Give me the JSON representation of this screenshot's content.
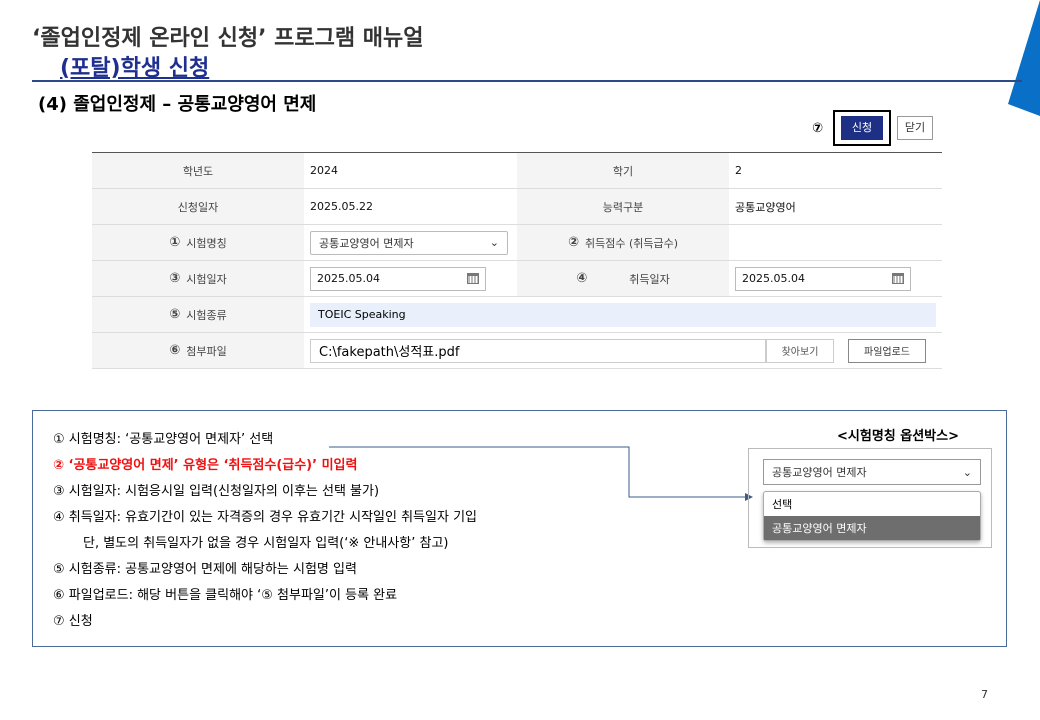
{
  "header": {
    "title": "‘졸업인정제 온라인 신청’ 프로그램 매뉴얼",
    "subtitle": "(포탈)학생 신청",
    "section": "(4) 졸업인정제 – 공통교양영어 면제"
  },
  "toolbar": {
    "marker": "⑦",
    "apply_label": "신청",
    "close_label": "닫기"
  },
  "form": {
    "year_label": "학년도",
    "year_value": "2024",
    "term_label": "학기",
    "term_value": "2",
    "apply_date_label": "신청일자",
    "apply_date_value": "2025.05.22",
    "ability_label": "능력구분",
    "ability_value": "공통교양영어",
    "exam_name_marker": "①",
    "exam_name_label": "시험명칭",
    "exam_name_value": "공통교양영어 면제자",
    "score_marker": "②",
    "score_label": "취득점수 (취득급수)",
    "exam_date_marker": "③",
    "exam_date_label": "시험일자",
    "exam_date_value": "2025.05.04",
    "acq_date_marker": "④",
    "acq_date_label": "취득일자",
    "acq_date_value": "2025.05.04",
    "exam_type_marker": "⑤",
    "exam_type_label": "시험종류",
    "exam_type_value": "TOEIC Speaking",
    "file_marker": "⑥",
    "file_label": "첨부파일",
    "file_value": "C:\\fakepath\\성적표.pdf",
    "browse_label": "찾아보기",
    "upload_label": "파일업로드"
  },
  "notes": {
    "line1": "① 시험명칭: ‘공통교양영어 면제자’ 선택",
    "line2": "② ‘공통교양영어 면제’ 유형은 ‘취득점수(급수)’ 미입력",
    "line3": "③ 시험일자: 시험응시일 입력(신청일자의 이후는 선택 불가)",
    "line4": "④ 취득일자: 유효기간이 있는 자격증의 경우 유효기간 시작일인 취득일자 기입",
    "line5": "단, 별도의 취득일자가 없을 경우 시험일자 입력(‘※ 안내사항’ 참고)",
    "line6": "⑤ 시험종류: 공통교양영어 면제에 해당하는 시험명 입력",
    "line7": "⑥ 파일업로드: 해당 버튼을 클릭해야 ‘⑤ 첨부파일’이 등록 완료",
    "line8": "⑦ 신청"
  },
  "option_box": {
    "title": "<시험명칭 옵션박스>",
    "selected": "공통교양영어 면제자",
    "options": [
      "선택",
      "공통교양영어 면제자"
    ]
  },
  "page_number": "7",
  "colors": {
    "accent": "#1e2f86",
    "corner": "#0a6fc6",
    "red": "#e11111"
  }
}
